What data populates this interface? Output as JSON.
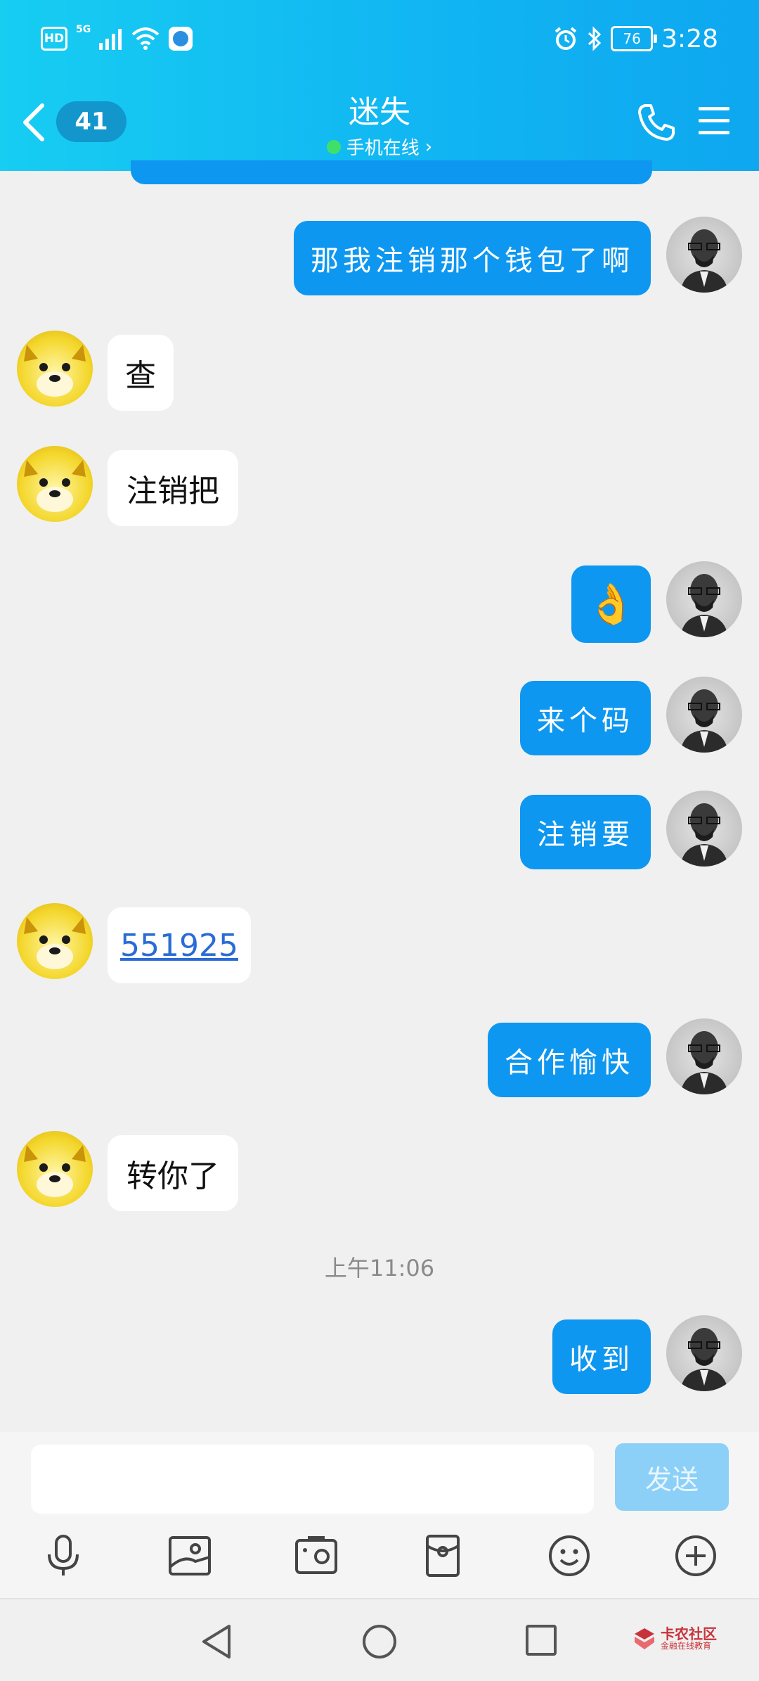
{
  "status_bar": {
    "hd": "HD",
    "network": "5G",
    "battery": "76",
    "time": "3:28"
  },
  "header": {
    "unread_count": "41",
    "contact_name": "迷失",
    "presence": "手机在线",
    "presence_color": "#3ee06b",
    "accent": "#11b6f2"
  },
  "messages": [
    {
      "side": "me",
      "text": "那我注销那个钱包了啊"
    },
    {
      "side": "them",
      "text": "查"
    },
    {
      "side": "them",
      "text": "注销把"
    },
    {
      "side": "me",
      "text": "👌"
    },
    {
      "side": "me",
      "text": "来个码"
    },
    {
      "side": "me",
      "text": "注销要"
    },
    {
      "side": "them",
      "text": "551925",
      "is_link": true
    },
    {
      "side": "me",
      "text": "合作愉快"
    },
    {
      "side": "them",
      "text": "转你了"
    },
    {
      "side": "me",
      "text": "收到"
    }
  ],
  "timestamp": "上午11:06",
  "input": {
    "value": "",
    "send_label": "发送"
  },
  "toolbar": [
    "mic-icon",
    "image-icon",
    "camera-icon",
    "red-packet-icon",
    "emoji-icon",
    "plus-icon"
  ],
  "watermark": {
    "main": "卡农社区",
    "sub": "金融在线教育"
  }
}
